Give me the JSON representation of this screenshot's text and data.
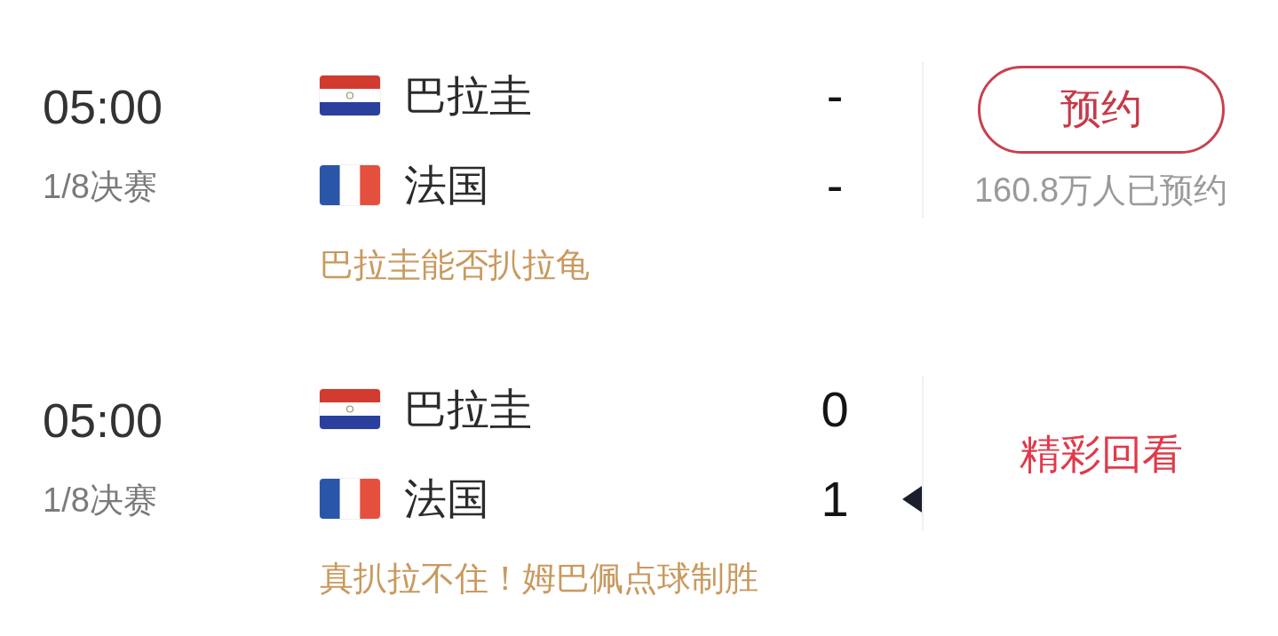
{
  "matches": [
    {
      "time": "05:00",
      "stage": "1/8决赛",
      "teams": [
        {
          "name": "巴拉圭",
          "flag": {
            "kind": "horizontal",
            "emblem": true,
            "stripes": [
              {
                "color": "#d23b2f"
              },
              {
                "color": "#ffffff"
              },
              {
                "color": "#2a3f9e"
              }
            ]
          },
          "score": "-",
          "winner": false
        },
        {
          "name": "法国",
          "flag": {
            "kind": "vertical",
            "emblem": false,
            "stripes": [
              {
                "color": "#2a56a8"
              },
              {
                "color": "#ffffff"
              },
              {
                "color": "#e5503e"
              }
            ]
          },
          "score": "-",
          "winner": false
        }
      ],
      "headline": "巴拉圭能否扒拉龟",
      "action": {
        "kind": "reserve",
        "label": "预约",
        "note": "160.8万人已预约"
      }
    },
    {
      "time": "05:00",
      "stage": "1/8决赛",
      "teams": [
        {
          "name": "巴拉圭",
          "flag": {
            "kind": "horizontal",
            "emblem": true,
            "stripes": [
              {
                "color": "#d23b2f"
              },
              {
                "color": "#ffffff"
              },
              {
                "color": "#2a3f9e"
              }
            ]
          },
          "score": "0",
          "winner": false
        },
        {
          "name": "法国",
          "flag": {
            "kind": "vertical",
            "emblem": false,
            "stripes": [
              {
                "color": "#2a56a8"
              },
              {
                "color": "#ffffff"
              },
              {
                "color": "#e5503e"
              }
            ]
          },
          "score": "1",
          "winner": true
        }
      ],
      "headline": "真扒拉不住！姆巴佩点球制胜",
      "action": {
        "kind": "replay",
        "label": "精彩回看"
      }
    }
  ]
}
